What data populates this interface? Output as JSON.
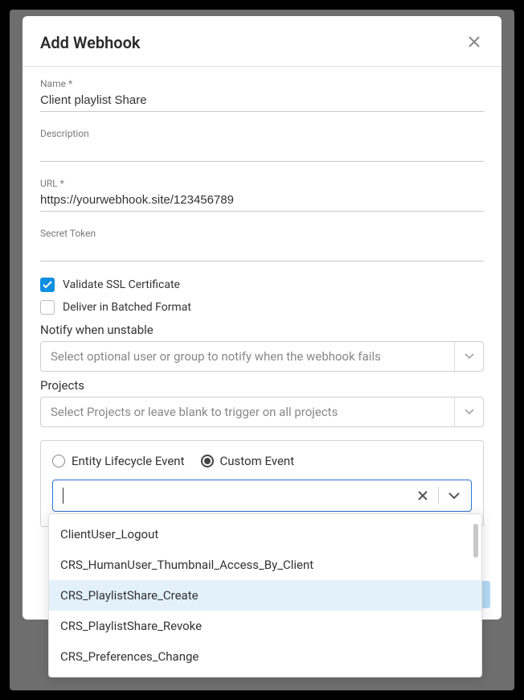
{
  "modal": {
    "title": "Add Webhook",
    "fields": {
      "name_label": "Name *",
      "name_value": "Client playlist Share",
      "description_label": "Description",
      "description_value": "",
      "url_label": "URL *",
      "url_value": "https://yourwebhook.site/123456789",
      "secret_label": "Secret Token",
      "secret_value": ""
    },
    "checkboxes": {
      "ssl_label": "Validate SSL Certificate",
      "ssl_checked": true,
      "batched_label": "Deliver in Batched Format",
      "batched_checked": false
    },
    "notify_label": "Notify when unstable",
    "notify_placeholder": "Select optional user or group to notify when the webhook fails",
    "projects_label": "Projects",
    "projects_placeholder": "Select Projects or leave blank to trigger on all projects",
    "event_radio": {
      "lifecycle_label": "Entity Lifecycle Event",
      "custom_label": "Custom Event",
      "selected": "custom"
    }
  },
  "dropdown": {
    "items": [
      "ClientUser_Logout",
      "CRS_HumanUser_Thumbnail_Access_By_Client",
      "CRS_PlaylistShare_Create",
      "CRS_PlaylistShare_Revoke",
      "CRS_Preferences_Change"
    ],
    "highlighted_index": 2
  }
}
